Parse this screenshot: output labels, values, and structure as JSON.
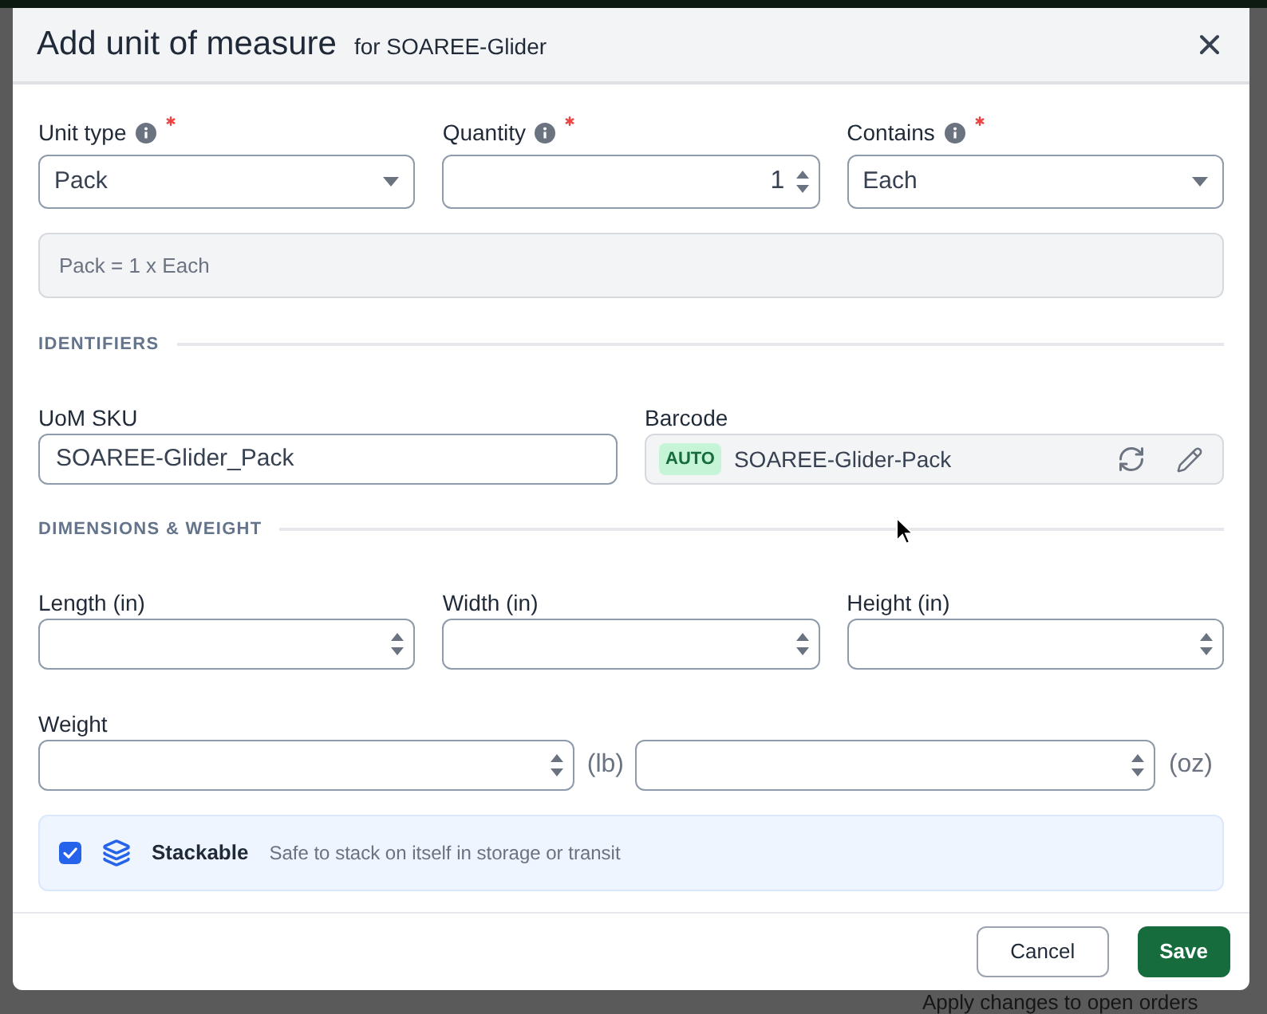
{
  "dialog": {
    "title": "Add unit of measure",
    "subtitle": "for SOAREE-Glider"
  },
  "unit_fields": [
    {
      "label": "Unit type",
      "required": true,
      "kind": "select",
      "value": "Pack"
    },
    {
      "label": "Quantity",
      "required": true,
      "kind": "number",
      "value": "1"
    },
    {
      "label": "Contains",
      "required": true,
      "kind": "select",
      "value": "Each"
    }
  ],
  "summary": "Pack = 1 x Each",
  "identifiers": {
    "heading": "IDENTIFIERS",
    "sku": {
      "label": "UoM SKU",
      "value": "SOAREE-Glider_Pack"
    },
    "barcode": {
      "label": "Barcode",
      "badge": "AUTO",
      "value": "SOAREE-Glider-Pack"
    }
  },
  "dimensions": {
    "heading": "DIMENSIONS & WEIGHT",
    "fields": [
      {
        "label": "Length (in)",
        "kind": "number"
      },
      {
        "label": "Width (in)",
        "kind": "number"
      },
      {
        "label": "Height (in)",
        "kind": "number"
      }
    ],
    "weight": {
      "label": "Weight",
      "inputs": [
        {
          "unit": "(lb)"
        },
        {
          "unit": "(oz)"
        }
      ]
    }
  },
  "stackable": {
    "label": "Stackable",
    "description": "Safe to stack on itself in storage or transit",
    "checked": true
  },
  "buttons": [
    {
      "label": "Cancel",
      "kind": "secondary"
    },
    {
      "label": "Save",
      "kind": "primary"
    }
  ],
  "background": {
    "text": "Apply changes to open orders"
  }
}
